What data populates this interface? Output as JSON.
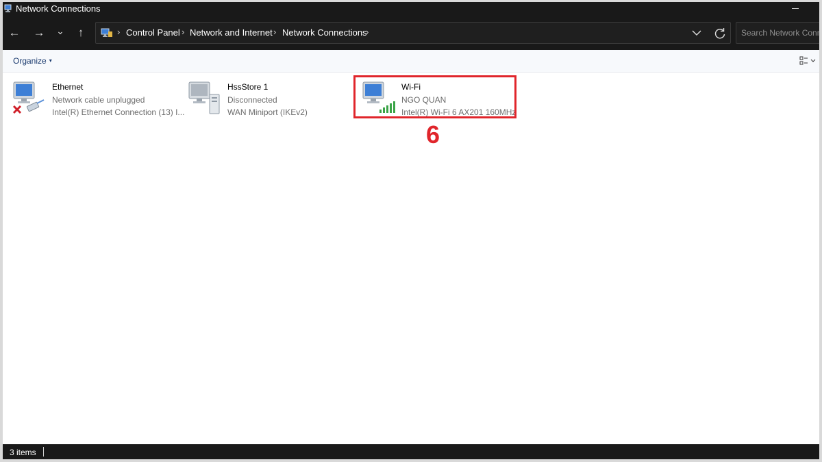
{
  "window": {
    "title": "Network Connections"
  },
  "nav": {
    "back_icon": "←",
    "forward_icon": "→",
    "recent_icon": "⌄",
    "up_icon": "↑"
  },
  "address": {
    "separator": "›",
    "crumbs": [
      "Control Panel",
      "Network and Internet",
      "Network Connections"
    ]
  },
  "search": {
    "placeholder": "Search Network Conn"
  },
  "toolbar": {
    "organize_label": "Organize",
    "organize_caret": "▾"
  },
  "connections": [
    {
      "name": "Ethernet",
      "status": "Network cable unplugged",
      "device": "Intel(R) Ethernet Connection (13) I..."
    },
    {
      "name": "HssStore 1",
      "status": "Disconnected",
      "device": "WAN Miniport (IKEv2)"
    },
    {
      "name": "Wi-Fi",
      "status": "NGO QUAN",
      "device": "Intel(R) Wi-Fi 6 AX201 160MHz"
    }
  ],
  "annotation": {
    "step": "6",
    "color": "#e0252b"
  },
  "statusbar": {
    "item_count": "3 items"
  },
  "colors": {
    "dark_chrome": "#191919",
    "link_blue": "#1b3b6f",
    "error_red": "#d0202a",
    "signal_green": "#3aa447"
  }
}
